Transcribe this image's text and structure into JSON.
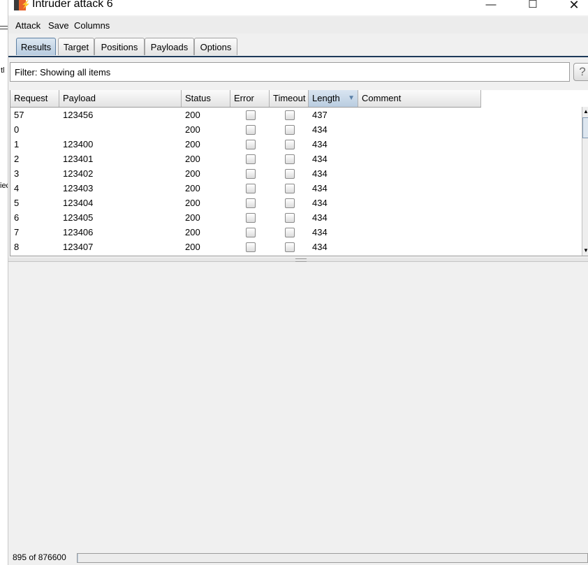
{
  "window": {
    "title": "Intruder attack 6"
  },
  "menu": [
    "Attack",
    "Save",
    "Columns"
  ],
  "tabs": [
    {
      "label": "Results",
      "active": true
    },
    {
      "label": "Target",
      "active": false
    },
    {
      "label": "Positions",
      "active": false
    },
    {
      "label": "Payloads",
      "active": false
    },
    {
      "label": "Options",
      "active": false
    }
  ],
  "filter": {
    "text": "Filter: Showing all items"
  },
  "help_label": "?",
  "table": {
    "columns": [
      "Request",
      "Payload",
      "Status",
      "Error",
      "Timeout",
      "Length",
      "Comment"
    ],
    "sorted_column": "Length",
    "rows": [
      {
        "request": "57",
        "payload": "123456",
        "status": "200",
        "error": false,
        "timeout": false,
        "length": "437",
        "comment": ""
      },
      {
        "request": "0",
        "payload": "",
        "status": "200",
        "error": false,
        "timeout": false,
        "length": "434",
        "comment": ""
      },
      {
        "request": "1",
        "payload": "123400",
        "status": "200",
        "error": false,
        "timeout": false,
        "length": "434",
        "comment": ""
      },
      {
        "request": "2",
        "payload": "123401",
        "status": "200",
        "error": false,
        "timeout": false,
        "length": "434",
        "comment": ""
      },
      {
        "request": "3",
        "payload": "123402",
        "status": "200",
        "error": false,
        "timeout": false,
        "length": "434",
        "comment": ""
      },
      {
        "request": "4",
        "payload": "123403",
        "status": "200",
        "error": false,
        "timeout": false,
        "length": "434",
        "comment": ""
      },
      {
        "request": "5",
        "payload": "123404",
        "status": "200",
        "error": false,
        "timeout": false,
        "length": "434",
        "comment": ""
      },
      {
        "request": "6",
        "payload": "123405",
        "status": "200",
        "error": false,
        "timeout": false,
        "length": "434",
        "comment": ""
      },
      {
        "request": "7",
        "payload": "123406",
        "status": "200",
        "error": false,
        "timeout": false,
        "length": "434",
        "comment": ""
      },
      {
        "request": "8",
        "payload": "123407",
        "status": "200",
        "error": false,
        "timeout": false,
        "length": "434",
        "comment": ""
      }
    ]
  },
  "status": {
    "progress_text": "895 of 876600",
    "progress_fraction": 0.001
  },
  "background_window": {
    "fragment1": "tl",
    "fragment2": "iec"
  },
  "icons": {
    "app": "burp-app-icon",
    "minimize": "minimize-icon",
    "maximize": "maximize-icon",
    "close": "close-icon",
    "sort": "sort-desc-icon"
  },
  "colors": {
    "accent_tab": "#b7cbdf",
    "burp_orange": "#e8622a"
  }
}
